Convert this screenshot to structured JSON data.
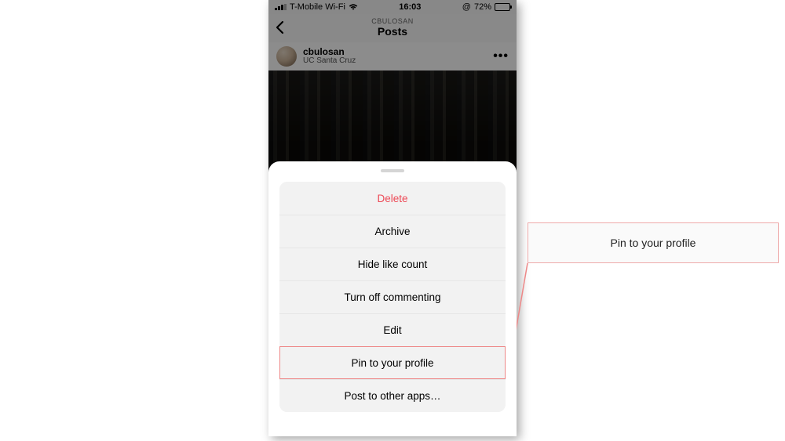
{
  "statusbar": {
    "carrier": "T-Mobile Wi-Fi",
    "time": "16:03",
    "battery_pct": "72%",
    "orientation_locked": "@"
  },
  "header": {
    "subtitle": "CBULOSAN",
    "title": "Posts"
  },
  "post": {
    "username": "cbulosan",
    "location": "UC Santa Cruz",
    "more": "•••"
  },
  "menu": {
    "items": [
      {
        "label": "Delete",
        "danger": true,
        "highlighted": false
      },
      {
        "label": "Archive",
        "danger": false,
        "highlighted": false
      },
      {
        "label": "Hide like count",
        "danger": false,
        "highlighted": false
      },
      {
        "label": "Turn off commenting",
        "danger": false,
        "highlighted": false
      },
      {
        "label": "Edit",
        "danger": false,
        "highlighted": false
      },
      {
        "label": "Pin to your profile",
        "danger": false,
        "highlighted": true
      },
      {
        "label": "Post to other apps…",
        "danger": false,
        "highlighted": false
      }
    ]
  },
  "callout": {
    "label": "Pin to your profile"
  },
  "colors": {
    "danger": "#ed4956",
    "callout_border": "#eeaaaa",
    "battery_fill": "#f7c948"
  }
}
